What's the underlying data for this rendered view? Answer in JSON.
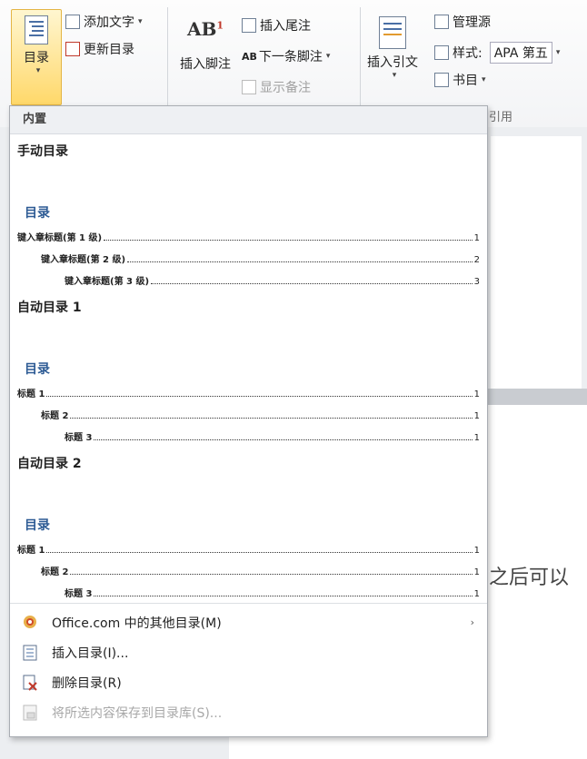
{
  "ribbon": {
    "toc_button": "目录",
    "add_text": "添加文字",
    "update_toc": "更新目录",
    "insert_footnote": "插入脚注",
    "ab_label": "AB",
    "ab_sup": "1",
    "insert_endnote": "插入尾注",
    "next_footnote": "下一条脚注",
    "ab_small": "AB",
    "show_notes": "显示备注",
    "insert_citation": "插入引文",
    "manage_sources": "管理源",
    "style_label": "样式:",
    "style_value": "APA 第五",
    "bibliography": "书目",
    "group_label": "引用"
  },
  "dropdown": {
    "header": "内置",
    "items": [
      {
        "title": "手动目录",
        "toc_heading": "目录",
        "lines": [
          {
            "label": "键入章标题(第 1 级)",
            "page": "1",
            "indent": 0
          },
          {
            "label": "键入章标题(第 2 级)",
            "page": "2",
            "indent": 26
          },
          {
            "label": "键入章标题(第 3 级)",
            "page": "3",
            "indent": 52
          }
        ]
      },
      {
        "title": "自动目录 1",
        "toc_heading": "目录",
        "lines": [
          {
            "label": "标题 1",
            "page": "1",
            "indent": 0
          },
          {
            "label": "标题 2",
            "page": "1",
            "indent": 26
          },
          {
            "label": "标题 3",
            "page": "1",
            "indent": 52
          }
        ]
      },
      {
        "title": "自动目录 2",
        "toc_heading": "目录",
        "lines": [
          {
            "label": "标题 1",
            "page": "1",
            "indent": 0
          },
          {
            "label": "标题 2",
            "page": "1",
            "indent": 26
          },
          {
            "label": "标题 3",
            "page": "1",
            "indent": 52
          }
        ]
      }
    ],
    "menu": {
      "more_office": "Office.com 中的其他目录(M)",
      "insert_toc": "插入目录(I)...",
      "remove_toc": "删除目录(R)",
      "save_selection": "将所选内容保存到目录库(S)..."
    }
  },
  "document": {
    "peek_text": "之后可以"
  }
}
